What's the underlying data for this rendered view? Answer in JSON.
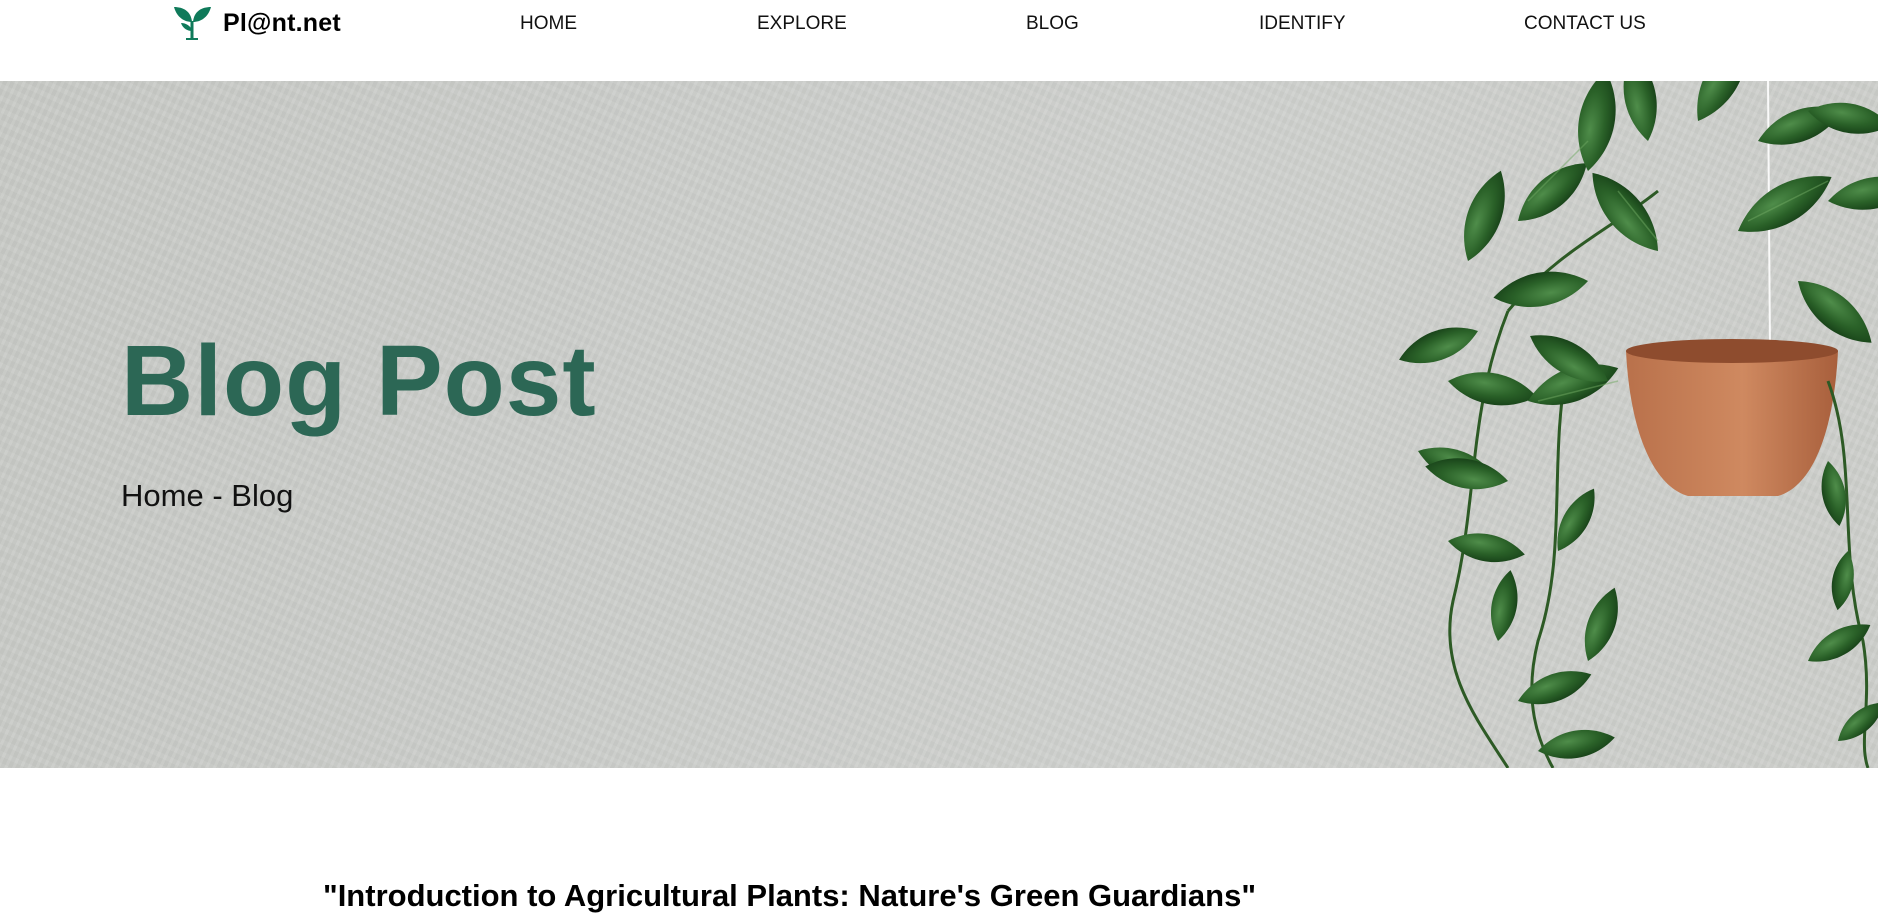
{
  "brand": {
    "name": "Pl@nt.net",
    "logo_icon": "sprout-icon",
    "logo_color": "#0f7a5a"
  },
  "nav": {
    "items": [
      {
        "label": "HOME"
      },
      {
        "label": "EXPLORE"
      },
      {
        "label": "BLOG"
      },
      {
        "label": "IDENTIFY"
      },
      {
        "label": "CONTACT US"
      }
    ]
  },
  "hero": {
    "title": "Blog Post",
    "title_color": "#2c6755",
    "breadcrumb": {
      "home": "Home",
      "separator": " - ",
      "current": "Blog"
    },
    "image": "hanging-pothos-plant-image"
  },
  "article": {
    "title": "\"Introduction to Agricultural Plants: Nature's Green Guardians\""
  }
}
